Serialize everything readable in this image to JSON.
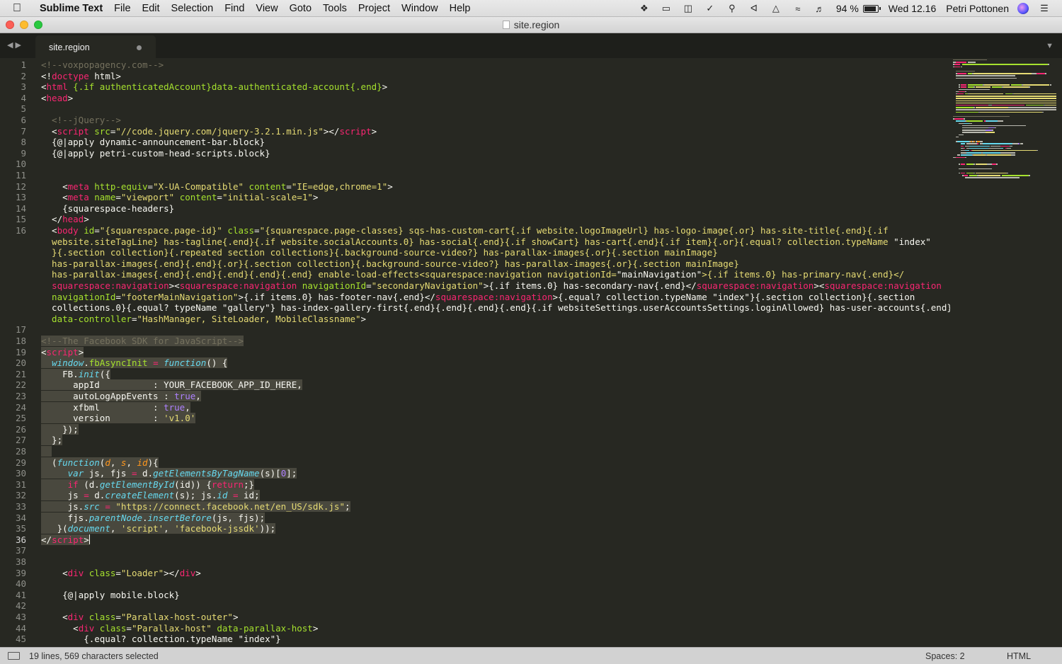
{
  "menubar": {
    "app_name": "Sublime Text",
    "menus": [
      "File",
      "Edit",
      "Selection",
      "Find",
      "View",
      "Goto",
      "Tools",
      "Project",
      "Window",
      "Help"
    ],
    "tray_icons": [
      "dropbox-icon",
      "display-icon",
      "screen-share-icon",
      "vcs-check-icon",
      "search-icon",
      "bluetooth-icon",
      "airplay-icon",
      "wifi-icon",
      "volume-icon"
    ],
    "battery": "94 %",
    "clock": "Wed 12.16",
    "user": "Petri Pottonen"
  },
  "window": {
    "title": "site.region"
  },
  "tabs": [
    {
      "label": "site.region",
      "modified": true
    }
  ],
  "statusbar": {
    "selection": "19 lines, 569 characters selected",
    "indentation": "Spaces: 2",
    "syntax": "HTML"
  },
  "editor": {
    "line_numbers": [
      "1",
      "2",
      "3",
      "4",
      "5",
      "6",
      "7",
      "8",
      "9",
      "10",
      "11",
      "12",
      "13",
      "14",
      "15",
      "16",
      "17",
      "18",
      "19",
      "20",
      "21",
      "22",
      "23",
      "24",
      "25",
      "26",
      "27",
      "28",
      "29",
      "30",
      "31",
      "32",
      "33",
      "34",
      "35",
      "36",
      "37",
      "38",
      "39",
      "40",
      "41",
      "42",
      "43",
      "44",
      "45"
    ],
    "current_line": "36",
    "lines": [
      {
        "n": "1",
        "s": [
          {
            "t": "<!--voxpopagency.com-->",
            "c": "cm"
          }
        ]
      },
      {
        "n": "2",
        "s": [
          {
            "t": "<!",
            "c": ""
          },
          {
            "t": "doctype",
            "c": "tg"
          },
          {
            "t": " html>",
            "c": ""
          }
        ]
      },
      {
        "n": "3",
        "s": [
          {
            "t": "<",
            "c": ""
          },
          {
            "t": "html",
            "c": "tg"
          },
          {
            "t": " {.if authenticatedAccount}data-authenticated-account{.end}",
            "c": "at"
          },
          {
            "t": ">",
            "c": ""
          }
        ]
      },
      {
        "n": "4",
        "s": [
          {
            "t": "<",
            "c": ""
          },
          {
            "t": "head",
            "c": "tg"
          },
          {
            "t": ">",
            "c": ""
          }
        ]
      },
      {
        "n": "5",
        "s": []
      },
      {
        "n": "6",
        "s": [
          {
            "t": "  <!--jQuery-->",
            "c": "cm"
          }
        ]
      },
      {
        "n": "7",
        "s": [
          {
            "t": "  <",
            "c": ""
          },
          {
            "t": "script",
            "c": "tg"
          },
          {
            "t": " src",
            "c": "at"
          },
          {
            "t": "=",
            "c": ""
          },
          {
            "t": "\"//code.jquery.com/jquery-3.2.1.min.js\"",
            "c": "st"
          },
          {
            "t": "></",
            "c": ""
          },
          {
            "t": "script",
            "c": "tg"
          },
          {
            "t": ">",
            "c": ""
          }
        ]
      },
      {
        "n": "8",
        "s": [
          {
            "t": "  {@|apply dynamic-announcement-bar.block}",
            "c": ""
          }
        ]
      },
      {
        "n": "9",
        "s": [
          {
            "t": "  {@|apply petri-custom-head-scripts.block}",
            "c": ""
          }
        ]
      },
      {
        "n": "10",
        "s": []
      },
      {
        "n": "11",
        "s": []
      },
      {
        "n": "12",
        "s": [
          {
            "t": "    <",
            "c": ""
          },
          {
            "t": "meta",
            "c": "tg"
          },
          {
            "t": " http-equiv",
            "c": "at"
          },
          {
            "t": "=",
            "c": ""
          },
          {
            "t": "\"X-UA-Compatible\"",
            "c": "st"
          },
          {
            "t": " content",
            "c": "at"
          },
          {
            "t": "=",
            "c": ""
          },
          {
            "t": "\"IE=edge,chrome=1\"",
            "c": "st"
          },
          {
            "t": ">",
            "c": ""
          }
        ]
      },
      {
        "n": "13",
        "s": [
          {
            "t": "    <",
            "c": ""
          },
          {
            "t": "meta",
            "c": "tg"
          },
          {
            "t": " name",
            "c": "at"
          },
          {
            "t": "=",
            "c": ""
          },
          {
            "t": "\"viewport\"",
            "c": "st"
          },
          {
            "t": " content",
            "c": "at"
          },
          {
            "t": "=",
            "c": ""
          },
          {
            "t": "\"initial-scale=1\"",
            "c": "st"
          },
          {
            "t": ">",
            "c": ""
          }
        ]
      },
      {
        "n": "14",
        "s": [
          {
            "t": "    {squarespace-headers}",
            "c": ""
          }
        ]
      },
      {
        "n": "15",
        "s": [
          {
            "t": "  </",
            "c": ""
          },
          {
            "t": "head",
            "c": "tg"
          },
          {
            "t": ">",
            "c": ""
          }
        ]
      },
      {
        "n": "16",
        "s": [
          {
            "t": "  <",
            "c": ""
          },
          {
            "t": "body",
            "c": "tg"
          },
          {
            "t": " id",
            "c": "at"
          },
          {
            "t": "=",
            "c": ""
          },
          {
            "t": "\"{squarespace.page-id}\"",
            "c": "st"
          },
          {
            "t": " class",
            "c": "at"
          },
          {
            "t": "=",
            "c": ""
          },
          {
            "t": "\"{squarespace.page-classes} sqs-has-custom-cart{.if website.logoImageUrl} has-logo-image{.or} has-site-title{.end}{.if",
            "c": "st"
          }
        ]
      },
      {
        "n": "",
        "s": [
          {
            "t": "  website.siteTagLine} has-tagline{.end}{.if website.socialAccounts.0} has-social{.end}{.if showCart} has-cart{.end}{.if item}{.or}{.equal? collection.typeName ",
            "c": "st"
          },
          {
            "t": "\"index\"",
            "c": ""
          }
        ]
      },
      {
        "n": "",
        "s": [
          {
            "t": "  }{.section collection}{.repeated section collections}{.background-source-video?} has-parallax-images{.or}{.section mainImage}",
            "c": "st"
          }
        ]
      },
      {
        "n": "",
        "s": [
          {
            "t": "  has-parallax-images{.end}{.end}{.or}{.section collection}{.background-source-video?} has-parallax-images{.or}{.section mainImage}",
            "c": "st"
          }
        ]
      },
      {
        "n": "",
        "s": [
          {
            "t": "  has-parallax-images{.end}{.end}{.end}{.end}{.end} enable-load-effects<squarespace:navigation navigationId=",
            "c": "st"
          },
          {
            "t": "\"mainNavigation\"",
            "c": ""
          },
          {
            "t": ">{.if items.0} has-primary-nav{.end}</",
            "c": "st"
          }
        ]
      },
      {
        "n": "",
        "s": [
          {
            "t": "  ",
            "c": ""
          },
          {
            "t": "squarespace:navigation",
            "c": "tg"
          },
          {
            "t": "><",
            "c": ""
          },
          {
            "t": "squarespace:navigation",
            "c": "tg"
          },
          {
            "t": " navigationId",
            "c": "at"
          },
          {
            "t": "=",
            "c": ""
          },
          {
            "t": "\"secondaryNavigation\"",
            "c": "st"
          },
          {
            "t": ">{.if items.0} has-secondary-nav{.end}</",
            "c": ""
          },
          {
            "t": "squarespace:navigation",
            "c": "tg"
          },
          {
            "t": "><",
            "c": ""
          },
          {
            "t": "squarespace:navigation",
            "c": "tg"
          }
        ]
      },
      {
        "n": "",
        "s": [
          {
            "t": "  navigationId",
            "c": "at"
          },
          {
            "t": "=",
            "c": ""
          },
          {
            "t": "\"footerMainNavigation\"",
            "c": "st"
          },
          {
            "t": ">{.if items.0} has-footer-nav{.end}</",
            "c": ""
          },
          {
            "t": "squarespace:navigation",
            "c": "tg"
          },
          {
            "t": ">{.equal? collection.typeName \"index\"}{.section collection}{.section",
            "c": ""
          }
        ]
      },
      {
        "n": "",
        "s": [
          {
            "t": "  collections.0}{.equal? typeName \"gallery\"} has-index-gallery-first{.end}{.end}{.end}{.end}{.if websiteSettings.userAccountsSettings.loginAllowed} has-user-accounts{.end}\"",
            "c": ""
          }
        ]
      },
      {
        "n": "",
        "s": [
          {
            "t": "  data-controller",
            "c": "at"
          },
          {
            "t": "=",
            "c": ""
          },
          {
            "t": "\"HashManager, SiteLoader, MobileClassname\"",
            "c": "st"
          },
          {
            "t": ">",
            "c": ""
          }
        ]
      },
      {
        "n": "17",
        "s": []
      },
      {
        "n": "18",
        "sel": true,
        "s": [
          {
            "t": "<!--The Facebook SDK for JavaScript-->",
            "c": "cm"
          }
        ]
      },
      {
        "n": "19",
        "sel": true,
        "s": [
          {
            "t": "<",
            "c": ""
          },
          {
            "t": "script",
            "c": "tg"
          },
          {
            "t": ">",
            "c": ""
          }
        ]
      },
      {
        "n": "20",
        "sel": true,
        "s": [
          {
            "t": "  ",
            "c": ""
          },
          {
            "t": "window",
            "c": "sp"
          },
          {
            "t": ".",
            "c": ""
          },
          {
            "t": "fbAsyncInit",
            "c": "fn"
          },
          {
            "t": " = ",
            "c": "kw"
          },
          {
            "t": "function",
            "c": "sp"
          },
          {
            "t": "() {",
            "c": ""
          }
        ]
      },
      {
        "n": "21",
        "sel": true,
        "s": [
          {
            "t": "    FB.",
            "c": ""
          },
          {
            "t": "init",
            "c": "sp"
          },
          {
            "t": "({",
            "c": ""
          }
        ]
      },
      {
        "n": "22",
        "sel": true,
        "s": [
          {
            "t": "      appId          : YOUR_FACEBOOK_APP_ID_HERE,",
            "c": ""
          }
        ]
      },
      {
        "n": "23",
        "sel": true,
        "s": [
          {
            "t": "      autoLogAppEvents : ",
            "c": ""
          },
          {
            "t": "true",
            "c": "nm"
          },
          {
            "t": ",",
            "c": ""
          }
        ]
      },
      {
        "n": "24",
        "sel": true,
        "s": [
          {
            "t": "      xfbml          : ",
            "c": ""
          },
          {
            "t": "true",
            "c": "nm"
          },
          {
            "t": ",",
            "c": ""
          }
        ]
      },
      {
        "n": "25",
        "sel": true,
        "s": [
          {
            "t": "      version        : ",
            "c": ""
          },
          {
            "t": "'v1.0'",
            "c": "st"
          }
        ]
      },
      {
        "n": "26",
        "sel": true,
        "s": [
          {
            "t": "    });",
            "c": ""
          }
        ]
      },
      {
        "n": "27",
        "sel": true,
        "s": [
          {
            "t": "  };",
            "c": ""
          }
        ]
      },
      {
        "n": "28",
        "sel": true,
        "s": [
          {
            "t": "  ",
            "c": ""
          }
        ]
      },
      {
        "n": "29",
        "sel": true,
        "s": [
          {
            "t": "  (",
            "c": ""
          },
          {
            "t": "function",
            "c": "sp"
          },
          {
            "t": "(",
            "c": ""
          },
          {
            "t": "d",
            "c": "pr"
          },
          {
            "t": ", ",
            "c": ""
          },
          {
            "t": "s",
            "c": "pr"
          },
          {
            "t": ", ",
            "c": ""
          },
          {
            "t": "id",
            "c": "pr"
          },
          {
            "t": "){",
            "c": ""
          }
        ]
      },
      {
        "n": "30",
        "sel": true,
        "s": [
          {
            "t": "     ",
            "c": ""
          },
          {
            "t": "var",
            "c": "sp"
          },
          {
            "t": " js, fjs ",
            "c": ""
          },
          {
            "t": "=",
            "c": "kw"
          },
          {
            "t": " d.",
            "c": ""
          },
          {
            "t": "getElementsByTagName",
            "c": "sp"
          },
          {
            "t": "(s)[",
            "c": ""
          },
          {
            "t": "0",
            "c": "nm"
          },
          {
            "t": "];",
            "c": ""
          }
        ]
      },
      {
        "n": "31",
        "sel": true,
        "s": [
          {
            "t": "     ",
            "c": ""
          },
          {
            "t": "if",
            "c": "kw"
          },
          {
            "t": " (d.",
            "c": ""
          },
          {
            "t": "getElementById",
            "c": "sp"
          },
          {
            "t": "(id)) {",
            "c": ""
          },
          {
            "t": "return",
            "c": "kw"
          },
          {
            "t": ";}",
            "c": ""
          }
        ]
      },
      {
        "n": "32",
        "sel": true,
        "s": [
          {
            "t": "     js ",
            "c": ""
          },
          {
            "t": "=",
            "c": "kw"
          },
          {
            "t": " d.",
            "c": ""
          },
          {
            "t": "createElement",
            "c": "sp"
          },
          {
            "t": "(s); js.",
            "c": ""
          },
          {
            "t": "id",
            "c": "sp"
          },
          {
            "t": " = ",
            "c": "kw"
          },
          {
            "t": "id;",
            "c": ""
          }
        ]
      },
      {
        "n": "33",
        "sel": true,
        "s": [
          {
            "t": "     js.",
            "c": ""
          },
          {
            "t": "src",
            "c": "sp"
          },
          {
            "t": " = ",
            "c": "kw"
          },
          {
            "t": "\"https://connect.facebook.net/en_US/sdk.js\"",
            "c": "st"
          },
          {
            "t": ";",
            "c": ""
          }
        ]
      },
      {
        "n": "34",
        "sel": true,
        "s": [
          {
            "t": "     fjs.",
            "c": ""
          },
          {
            "t": "parentNode",
            "c": "sp"
          },
          {
            "t": ".",
            "c": ""
          },
          {
            "t": "insertBefore",
            "c": "sp"
          },
          {
            "t": "(js, fjs);",
            "c": ""
          }
        ]
      },
      {
        "n": "35",
        "sel": true,
        "s": [
          {
            "t": "   }(",
            "c": ""
          },
          {
            "t": "document",
            "c": "sp"
          },
          {
            "t": ", ",
            "c": ""
          },
          {
            "t": "'script'",
            "c": "st"
          },
          {
            "t": ", ",
            "c": ""
          },
          {
            "t": "'facebook-jssdk'",
            "c": "st"
          },
          {
            "t": "));",
            "c": ""
          }
        ]
      },
      {
        "n": "36",
        "sel": true,
        "caret": true,
        "s": [
          {
            "t": "</",
            "c": ""
          },
          {
            "t": "script",
            "c": "tg"
          },
          {
            "t": ">",
            "c": ""
          }
        ]
      },
      {
        "n": "37",
        "s": []
      },
      {
        "n": "38",
        "s": []
      },
      {
        "n": "39",
        "s": [
          {
            "t": "    <",
            "c": ""
          },
          {
            "t": "div",
            "c": "tg"
          },
          {
            "t": " class",
            "c": "at"
          },
          {
            "t": "=",
            "c": ""
          },
          {
            "t": "\"Loader\"",
            "c": "st"
          },
          {
            "t": "></",
            "c": ""
          },
          {
            "t": "div",
            "c": "tg"
          },
          {
            "t": ">",
            "c": ""
          }
        ]
      },
      {
        "n": "40",
        "s": []
      },
      {
        "n": "41",
        "s": [
          {
            "t": "    {@|apply mobile.block}",
            "c": ""
          }
        ]
      },
      {
        "n": "42",
        "s": []
      },
      {
        "n": "43",
        "s": [
          {
            "t": "    <",
            "c": ""
          },
          {
            "t": "div",
            "c": "tg"
          },
          {
            "t": " class",
            "c": "at"
          },
          {
            "t": "=",
            "c": ""
          },
          {
            "t": "\"Parallax-host-outer\"",
            "c": "st"
          },
          {
            "t": ">",
            "c": ""
          }
        ]
      },
      {
        "n": "44",
        "s": [
          {
            "t": "      <",
            "c": ""
          },
          {
            "t": "div",
            "c": "tg"
          },
          {
            "t": " class",
            "c": "at"
          },
          {
            "t": "=",
            "c": ""
          },
          {
            "t": "\"Parallax-host\"",
            "c": "st"
          },
          {
            "t": " data-parallax-host",
            "c": "at"
          },
          {
            "t": ">",
            "c": ""
          }
        ]
      },
      {
        "n": "45",
        "s": [
          {
            "t": "        {.equal? collection.typeName \"index\"}",
            "c": ""
          }
        ]
      }
    ]
  },
  "colors": {
    "background": "#272822",
    "tag": "#f92672",
    "attribute": "#a6e22e",
    "string": "#e6db74",
    "comment": "#75715e",
    "storage": "#66d9ef",
    "selection": "#49483e"
  }
}
